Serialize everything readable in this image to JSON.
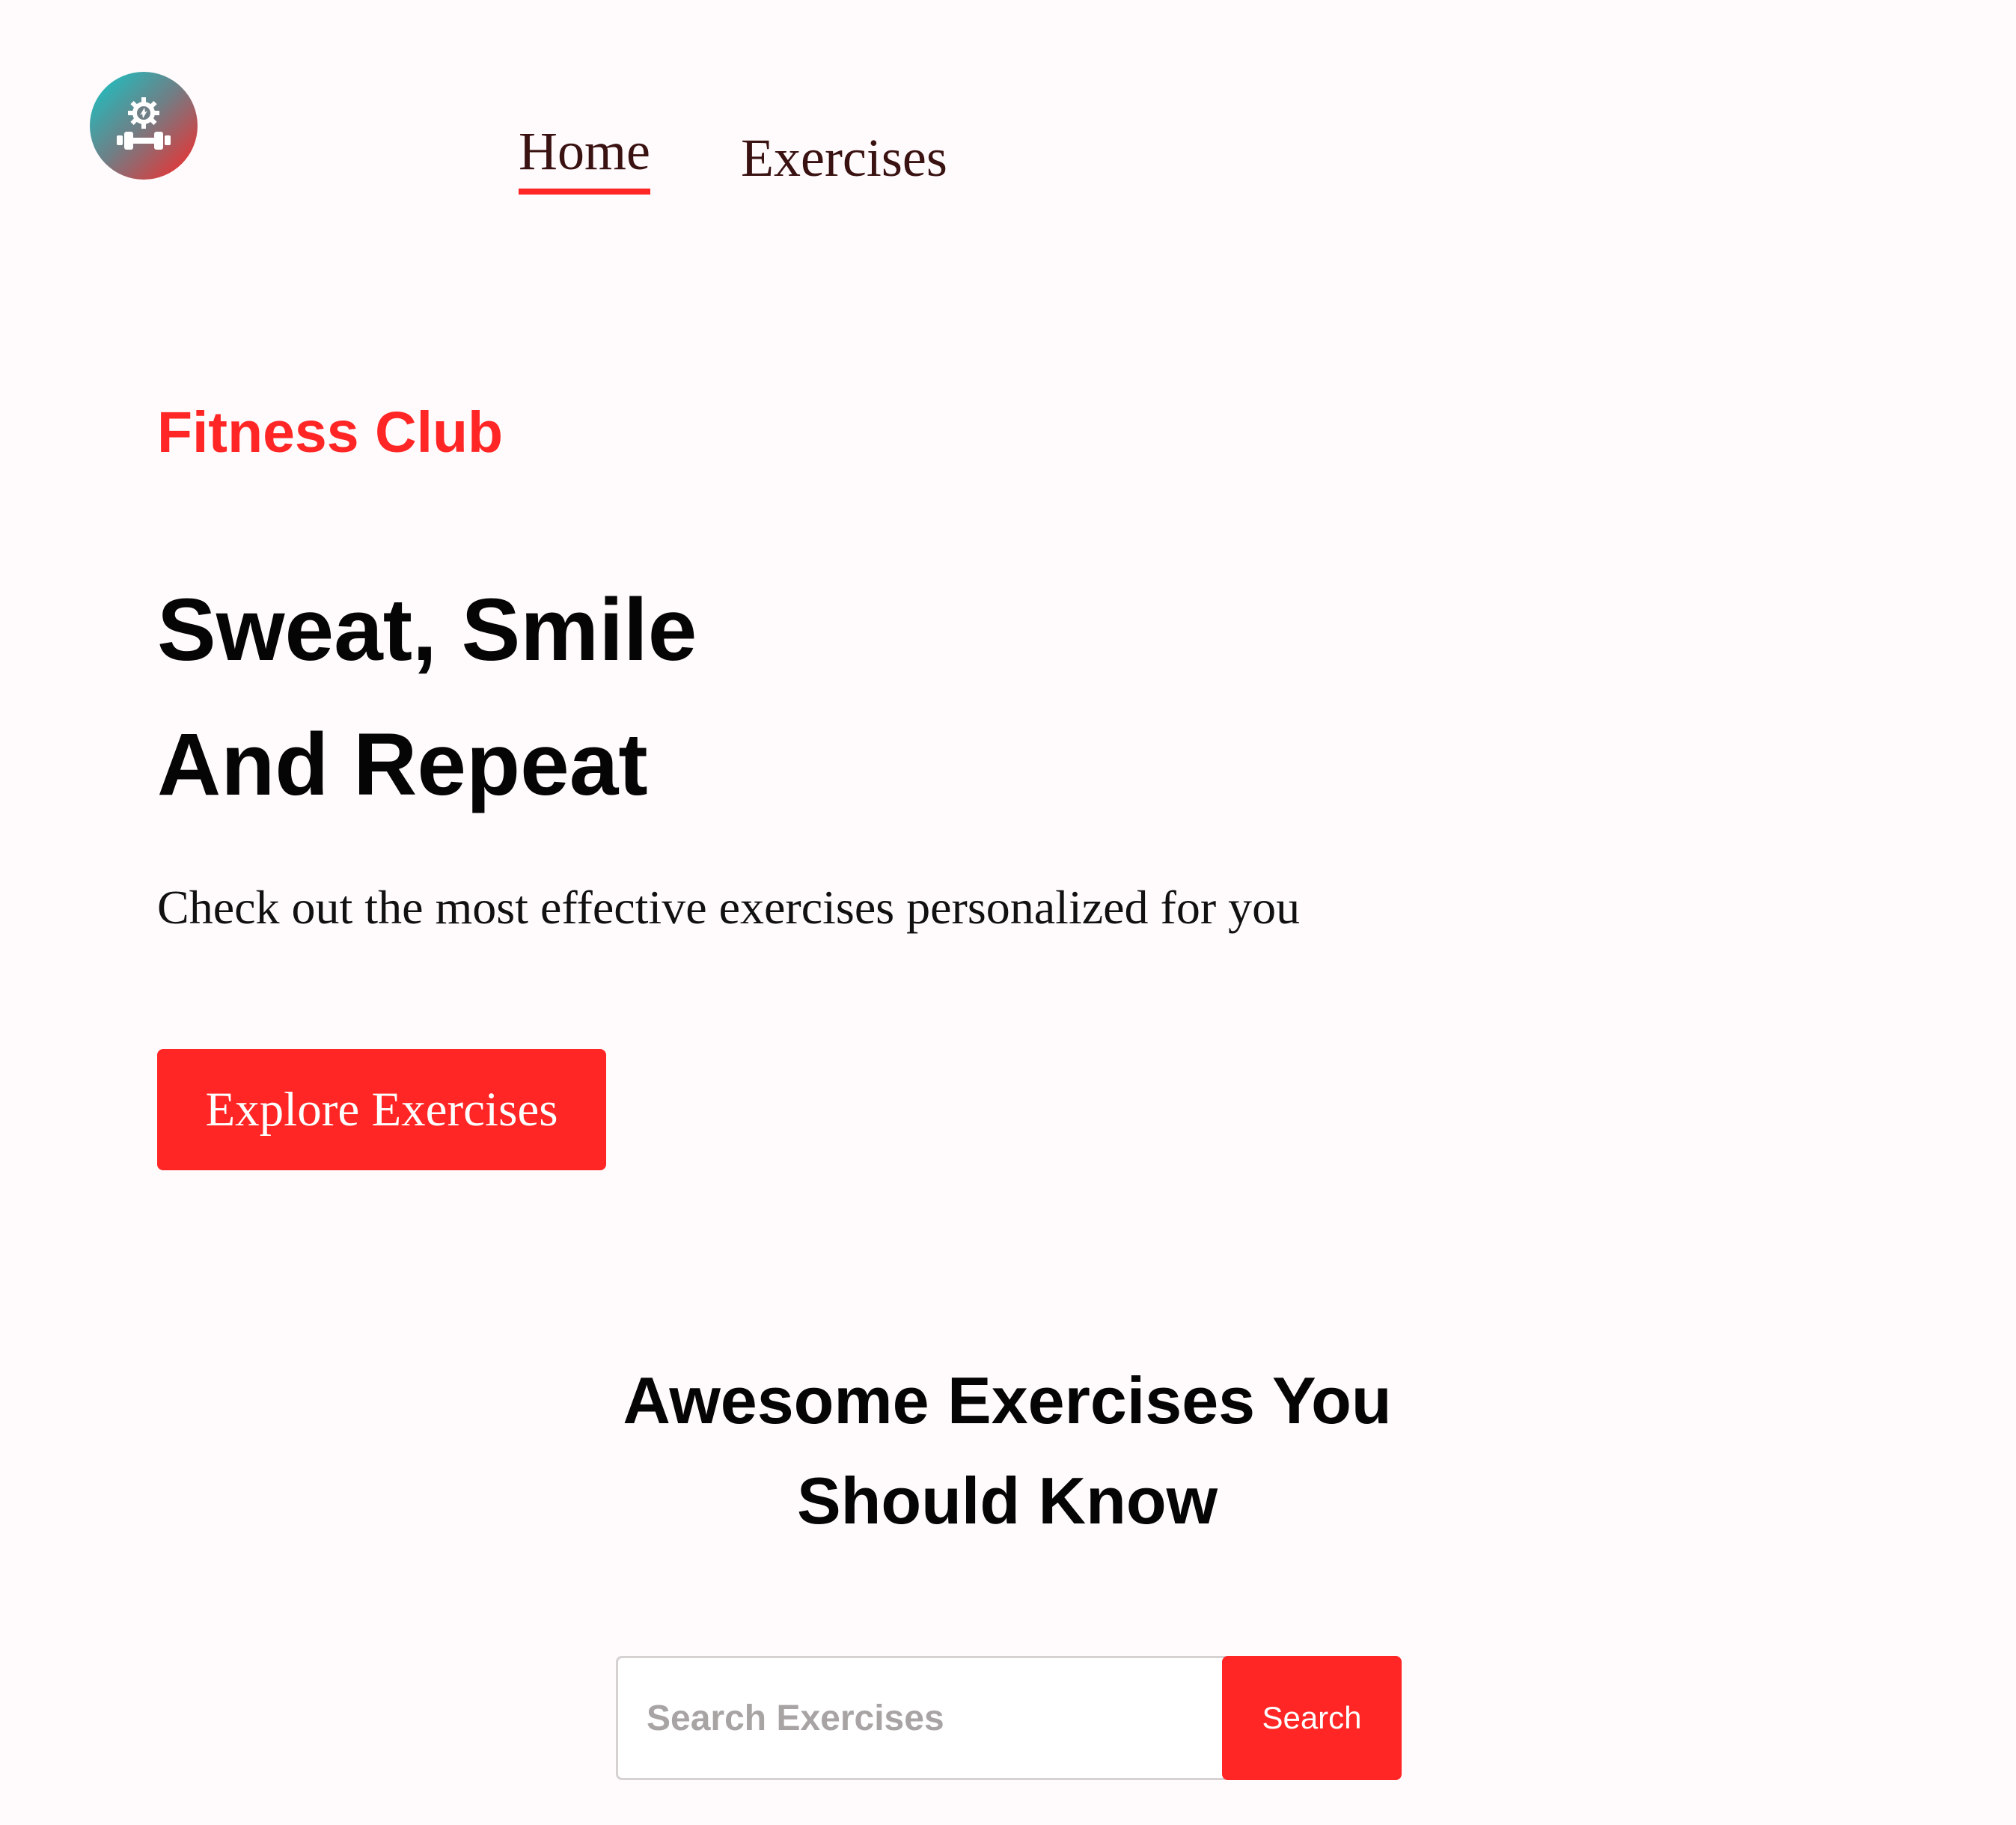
{
  "nav": {
    "logo_icon": "dumbbell-gear-icon",
    "links": [
      {
        "label": "Home",
        "active": true
      },
      {
        "label": "Exercises",
        "active": false
      }
    ]
  },
  "hero": {
    "kicker": "Fitness Club",
    "title_line_1": "Sweat, Smile",
    "title_line_2": "And Repeat",
    "subtitle": "Check out the most effective exercises personalized for you",
    "cta_label": "Explore Exercises"
  },
  "exercises_section": {
    "heading_line_1": "Awesome Exercises You",
    "heading_line_2": "Should Know",
    "search": {
      "placeholder": "Search Exercises",
      "value": "",
      "button_label": "Search"
    }
  },
  "colors": {
    "accent": "#ff2625",
    "background": "#fffafb",
    "nav_text": "#3a1212"
  }
}
